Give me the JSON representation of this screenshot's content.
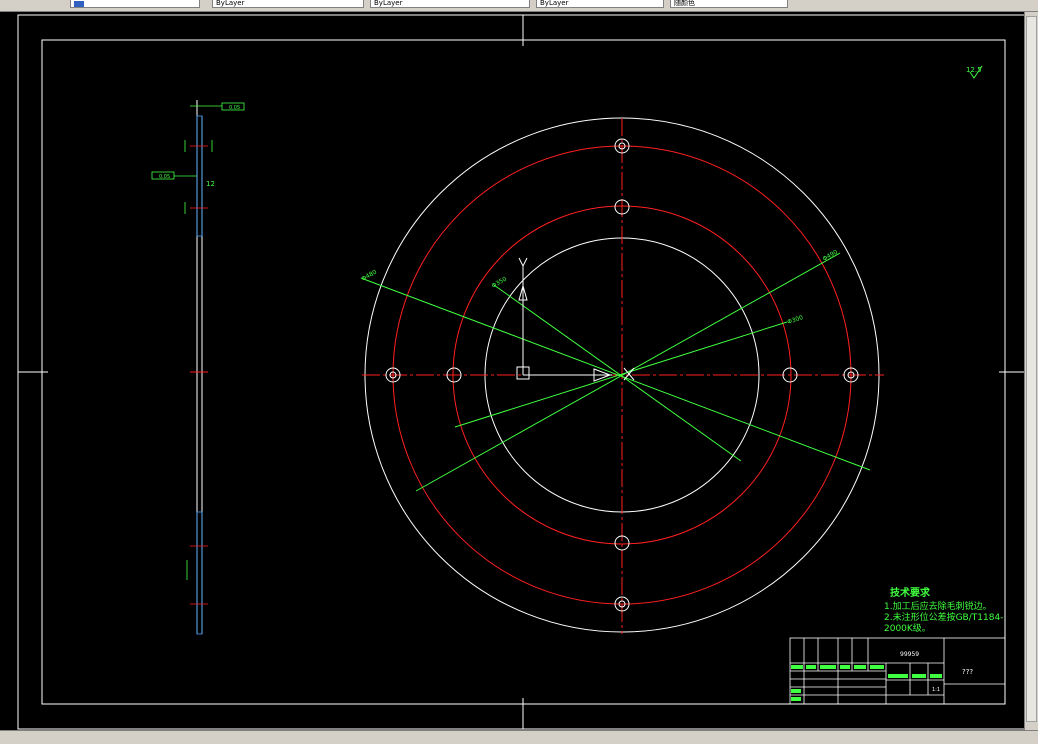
{
  "toolbar": {
    "fields": [
      "ByLayer",
      "ByLayer",
      "ByLayer",
      "随颜色"
    ]
  },
  "drawing": {
    "colors": {
      "border": "#ffffff",
      "center": "#ff2020",
      "dim": "#40ff40"
    },
    "surface_finish": "12.5",
    "profile_labels": {
      "thickness": "12",
      "tolerance_a": "0.05",
      "tolerance_b": "0.05"
    },
    "diameter_labels": [
      "Φ480",
      "Φ350",
      "Φ490",
      "Φ300"
    ],
    "tech_requirements": {
      "title": "技术要求",
      "items": [
        "1.加工后应去除毛刺锐边。",
        "2.未注形位公差按GB/T1184-2000K级。"
      ]
    },
    "title_block": {
      "drawing_no": "99959",
      "part_name": "???",
      "scale": "1:1"
    }
  }
}
